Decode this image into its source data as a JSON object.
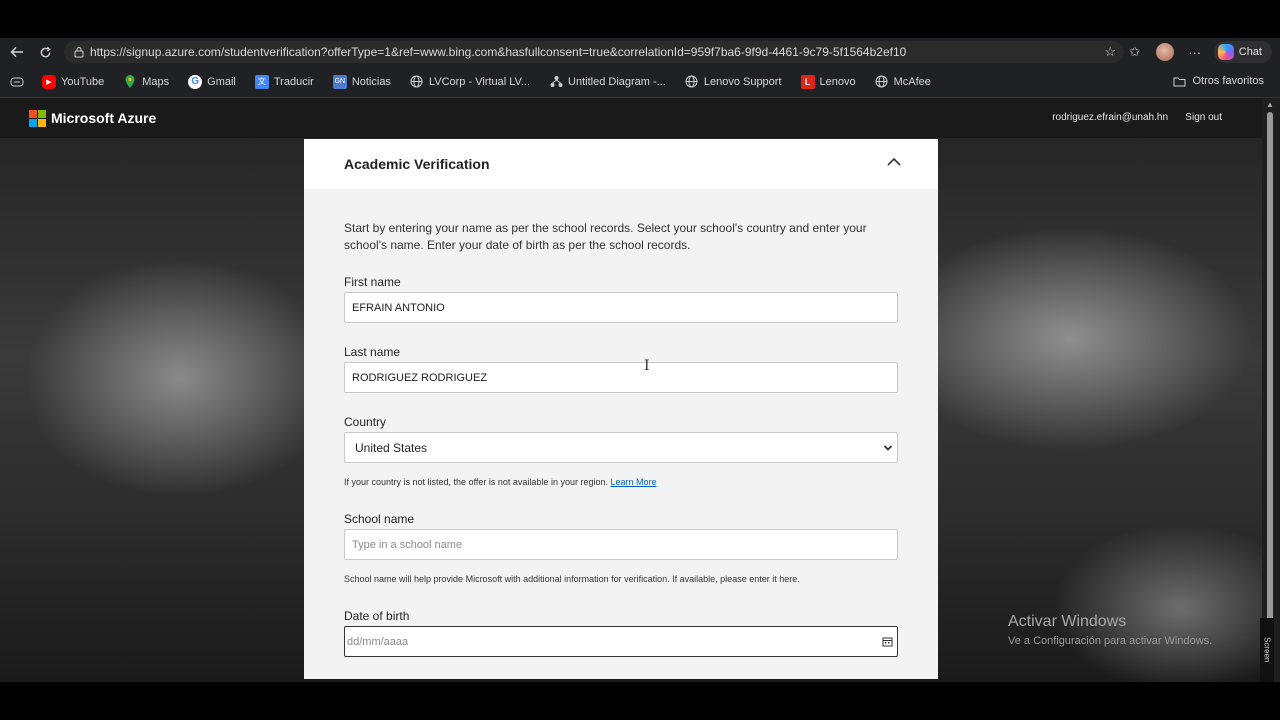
{
  "browser": {
    "url": "https://signup.azure.com/studentverification?offerType=1&ref=www.bing.com&hasfullconsent=true&correlationId=959f7ba6-9f9d-4461-9c79-5f1564b2ef10",
    "chat_label": "Chat",
    "bookmarks": [
      {
        "label": "YouTube",
        "icon": "youtube-icon",
        "color": "#ff0000"
      },
      {
        "label": "Maps",
        "icon": "maps-icon",
        "color": "#34a853"
      },
      {
        "label": "Gmail",
        "icon": "google-icon",
        "color": "#ffffff"
      },
      {
        "label": "Traducir",
        "icon": "translate-icon",
        "color": "#4285f4"
      },
      {
        "label": "Noticias",
        "icon": "news-icon",
        "color": "#4a7bd0"
      },
      {
        "label": "LVCorp - Virtual LV...",
        "icon": "globe-icon",
        "color": "#cfcfcf"
      },
      {
        "label": "Untitled Diagram -...",
        "icon": "diagram-icon",
        "color": "#cfcfcf"
      },
      {
        "label": "Lenovo Support",
        "icon": "globe-icon",
        "color": "#cfcfcf"
      },
      {
        "label": "Lenovo",
        "icon": "lenovo-icon",
        "color": "#e2231a"
      },
      {
        "label": "McAfee",
        "icon": "globe-icon",
        "color": "#cfcfcf"
      }
    ],
    "other_favorites": "Otros favoritos"
  },
  "azure": {
    "brand": "Microsoft Azure",
    "user_email": "rodriguez.efrain@unah.hn",
    "sign_out": "Sign out"
  },
  "form": {
    "title": "Academic Verification",
    "intro": "Start by entering your name as per the school records. Select your school's country and enter your school's name. Enter your date of birth as per the school records.",
    "first_name_label": "First name",
    "first_name_value": "EFRAIN ANTONIO",
    "last_name_label": "Last name",
    "last_name_value": "RODRIGUEZ RODRIGUEZ",
    "country_label": "Country",
    "country_value": "United States",
    "country_help": "If your country is not listed, the offer is not available in your region.",
    "learn_more": "Learn More",
    "school_label": "School name",
    "school_placeholder": "Type in a school name",
    "school_help": "School name will help provide Microsoft with additional information for verification. If available, please enter it here.",
    "dob_label": "Date of birth",
    "dob_placeholder": "dd/mm/aaaa"
  },
  "watermark": {
    "title": "Activar Windows",
    "subtitle": "Ve a Configuración para activar Windows.",
    "badge": "Screen"
  },
  "colors": {
    "ms_red": "#f25022",
    "ms_green": "#7fba00",
    "ms_blue": "#00a4ef",
    "ms_yellow": "#ffb900",
    "link": "#0067b8"
  }
}
